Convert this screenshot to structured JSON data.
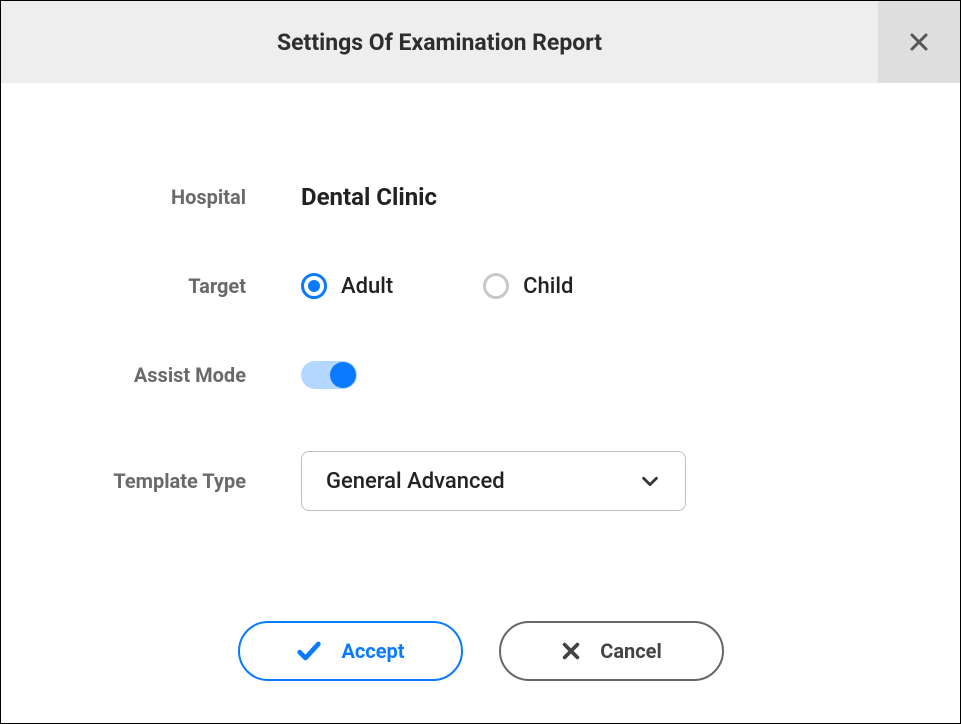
{
  "header": {
    "title": "Settings Of Examination Report"
  },
  "form": {
    "hospital": {
      "label": "Hospital",
      "value": "Dental Clinic"
    },
    "target": {
      "label": "Target",
      "options": [
        {
          "label": "Adult",
          "selected": true
        },
        {
          "label": "Child",
          "selected": false
        }
      ]
    },
    "assist_mode": {
      "label": "Assist Mode",
      "enabled": true
    },
    "template_type": {
      "label": "Template Type",
      "selected": "General Advanced"
    }
  },
  "buttons": {
    "accept": "Accept",
    "cancel": "Cancel"
  }
}
